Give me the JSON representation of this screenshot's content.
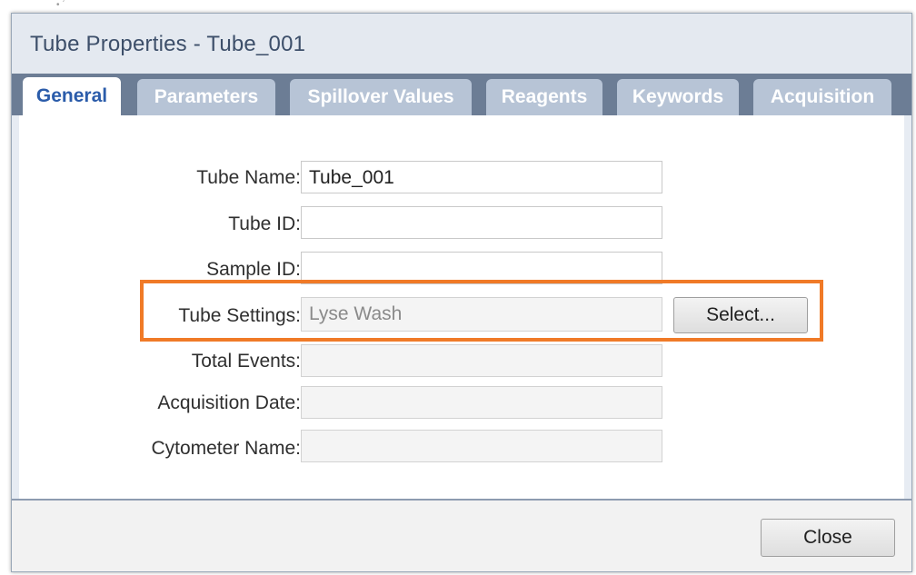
{
  "window": {
    "title": "Tube Properties - Tube_001"
  },
  "tabs": [
    {
      "label": "General",
      "active": true
    },
    {
      "label": "Parameters",
      "active": false
    },
    {
      "label": "Spillover Values",
      "active": false
    },
    {
      "label": "Reagents",
      "active": false
    },
    {
      "label": "Keywords",
      "active": false
    },
    {
      "label": "Acquisition",
      "active": false
    }
  ],
  "form": {
    "tube_name": {
      "label": "Tube Name:",
      "value": "Tube_001"
    },
    "tube_id": {
      "label": "Tube ID:",
      "value": ""
    },
    "sample_id": {
      "label": "Sample ID:",
      "value": ""
    },
    "tube_settings": {
      "label": "Tube Settings:",
      "value": "Lyse Wash",
      "button_label": "Select..."
    },
    "total_events": {
      "label": "Total Events:",
      "value": ""
    },
    "acquisition_date": {
      "label": "Acquisition Date:",
      "value": ""
    },
    "cytometer_name": {
      "label": "Cytometer Name:",
      "value": ""
    }
  },
  "footer": {
    "close_label": "Close"
  },
  "colors": {
    "highlight": "#f07a27",
    "tab_strip": "#6c7d95",
    "active_tab_text": "#2b5caa",
    "title_text": "#3d4f6a"
  }
}
